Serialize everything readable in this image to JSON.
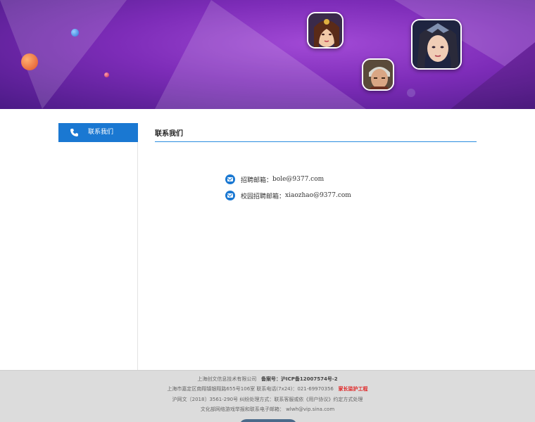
{
  "colors": {
    "accent": "#1a78d2",
    "banner": "#7d2cb8",
    "footer_bg": "#dcdcdc",
    "red": "#e02020"
  },
  "banner": {
    "avatars": [
      "female-warrior-avatar",
      "male-warrior-avatar",
      "dark-sorceress-avatar"
    ]
  },
  "sidebar": {
    "items": [
      {
        "label": "联系我们",
        "icon": "phone-icon"
      }
    ]
  },
  "main": {
    "title": "联系我们",
    "contacts": [
      {
        "label": "招聘邮箱：",
        "value": "bole@9377.com",
        "icon": "mail-icon"
      },
      {
        "label": "校园招聘邮箱：",
        "value": "xiaozhao@9377.com",
        "icon": "mail-icon"
      }
    ]
  },
  "footer": {
    "company": "上海创文信息技术有限公司",
    "icp": "备案号：沪ICP备12007574号-2",
    "address": "上海市嘉定区南翔镇银翔路655号106室 联系电话(7x24)：021-69970356",
    "guardian": "家长监护工程",
    "license": "沪网文〔2018〕3561-290号 纠纷处理方式：联系客服或依《用户协议》约定方式处理",
    "culture": "文化部网络游戏举报和联系电子邮箱： wlwh@vip.sina.com"
  }
}
